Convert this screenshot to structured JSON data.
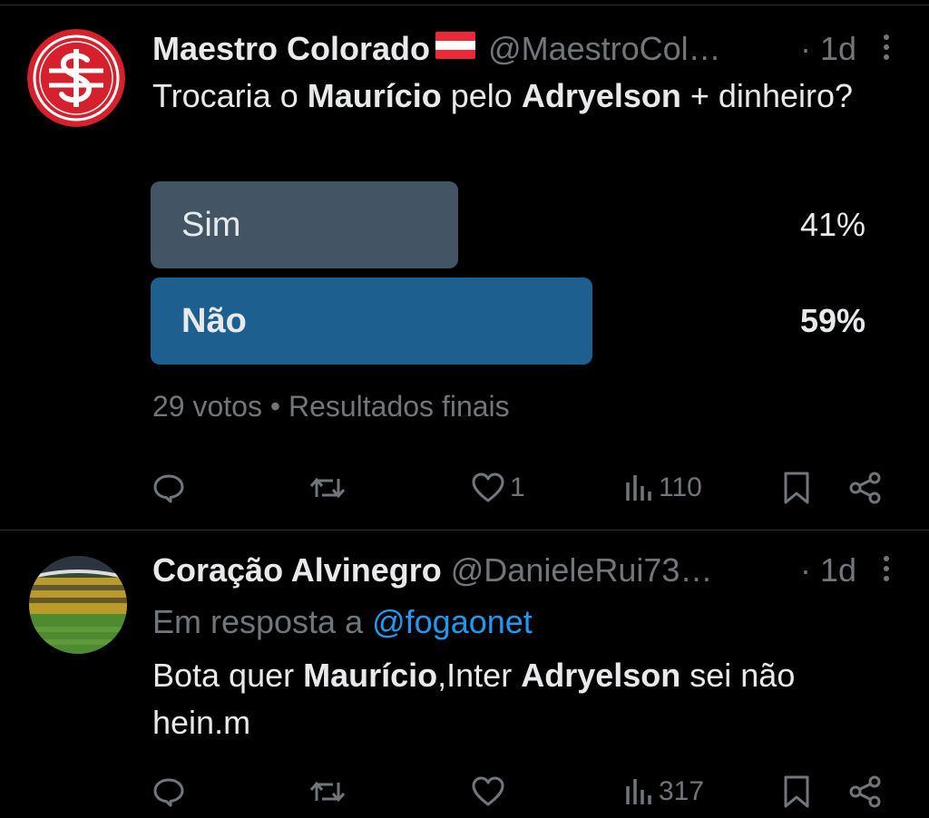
{
  "tweets": [
    {
      "author_name": "Maestro Colorado",
      "author_flag": "Austrian flag emoji",
      "handle": "@MaestroCol…",
      "time": "· 1d",
      "text": {
        "p1": "Trocaria o ",
        "b1": "Maurício",
        "p2": " pelo ",
        "b2": "Adryelson",
        "p3": " + dinheiro?"
      },
      "poll": {
        "options": [
          {
            "label": "Sim",
            "percent": "41%",
            "fraction": 0.41
          },
          {
            "label": "Não",
            "percent": "59%",
            "fraction": 0.59,
            "winner": true
          }
        ],
        "votes": "29 votos",
        "separator": " • ",
        "status": "Resultados finais"
      },
      "actions": {
        "replies": "",
        "retweets": "",
        "likes": "1",
        "views": "110"
      }
    },
    {
      "author_name": "Coração Alvinegro",
      "handle": "@DanieleRui73…",
      "time": "· 1d",
      "reply_prefix": "Em resposta a ",
      "reply_mention": "@fogaonet",
      "text": {
        "b1": "Maurício",
        "b2": "Adryelson",
        "p1": "Bota quer ",
        "p2": ",Inter ",
        "p3": " sei não hein.m"
      },
      "actions": {
        "replies": "",
        "retweets": "",
        "likes": "",
        "views": "317"
      }
    }
  ],
  "icons": {
    "reply": "speech-bubble-icon",
    "retweet": "retweet-arrows-icon",
    "like": "heart-icon",
    "views": "bar-chart-icon",
    "bookmark": "bookmark-icon",
    "share": "share-nodes-icon",
    "more": "vertical-ellipsis-icon"
  },
  "colors": {
    "background": "#000000",
    "text": "#e7e9ea",
    "muted": "#71767b",
    "link": "#1d9bf0",
    "poll_bar": "#435564",
    "poll_bar_winner": "#1d5f8f",
    "divider": "#2f3336"
  }
}
